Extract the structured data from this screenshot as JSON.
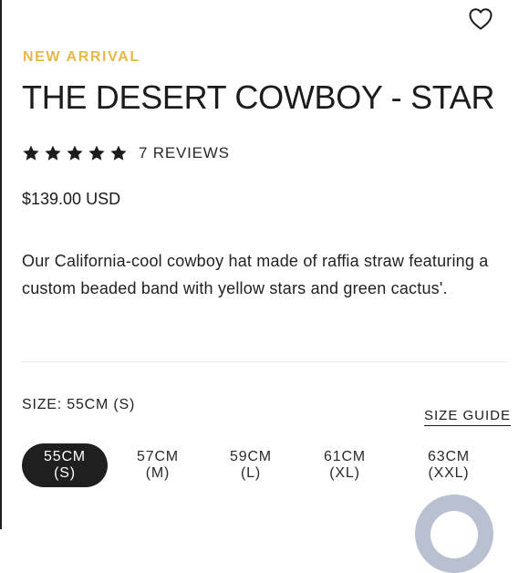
{
  "product": {
    "badge": "NEW ARRIVAL",
    "title": "THE DESERT COWBOY - STAR",
    "rating": {
      "stars": 5,
      "reviews_label": "7 REVIEWS"
    },
    "price": "$139.00 USD",
    "description": "Our California-cool cowboy hat made of raffia straw featuring a custom beaded band with yellow stars and green cactus'."
  },
  "size": {
    "label": "SIZE: 55CM (S)",
    "guide_label": "SIZE GUIDE",
    "options": [
      {
        "cm": "55CM",
        "code": "(S)",
        "selected": true
      },
      {
        "cm": "57CM",
        "code": "(M)",
        "selected": false
      },
      {
        "cm": "59CM",
        "code": "(L)",
        "selected": false
      },
      {
        "cm": "61CM",
        "code": "(XL)",
        "selected": false
      },
      {
        "cm": "63CM",
        "code": "(XXL)",
        "selected": false
      }
    ]
  },
  "icons": {
    "wishlist": "heart-outline-icon",
    "rating": "star-icon",
    "chat": "chat-launcher-icon"
  },
  "colors": {
    "accent": "#e6b94a",
    "text": "#1c1c1c",
    "selected_bg": "#1f1f1f",
    "chat_bubble": "#b9c0cf"
  }
}
